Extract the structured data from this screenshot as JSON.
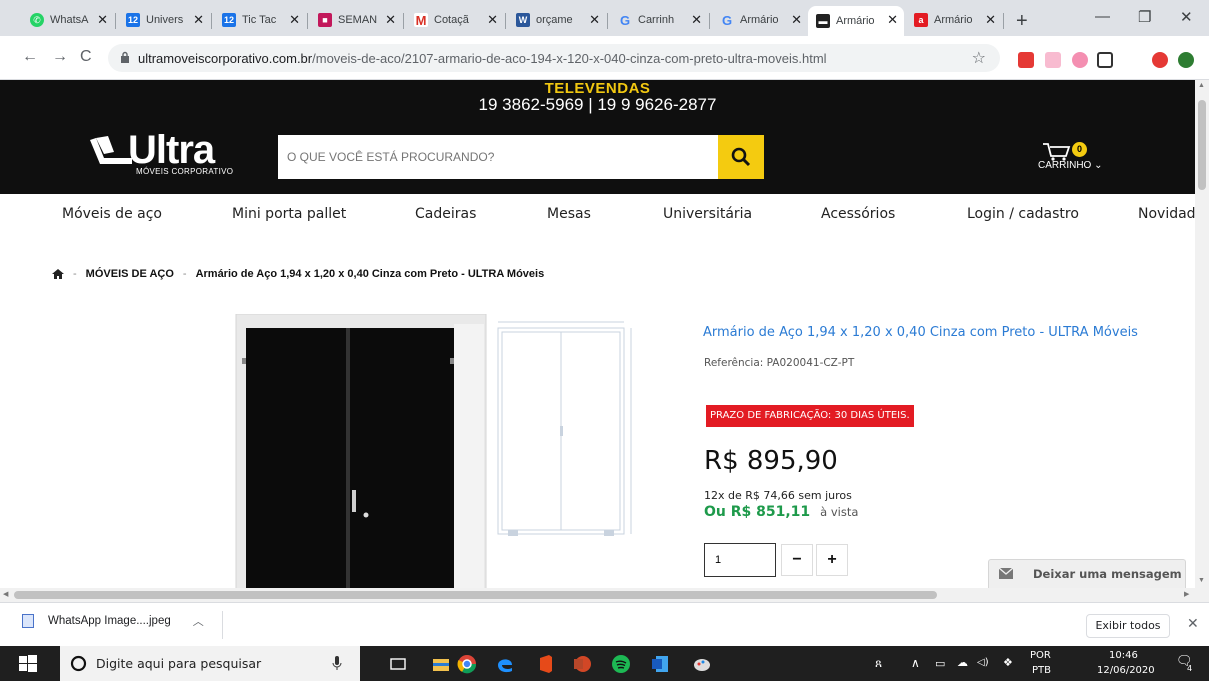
{
  "browser": {
    "tabs": [
      {
        "label": "WhatsA",
        "icon": "whatsapp-icon",
        "color": "#25d366"
      },
      {
        "label": "Univers",
        "icon": "calendar-icon",
        "color": "#1a73e8"
      },
      {
        "label": "Tic Tac",
        "icon": "calendar-icon",
        "color": "#1a73e8"
      },
      {
        "label": "SEMAN",
        "icon": "classroom-icon",
        "color": "#c2185b"
      },
      {
        "label": "Cotaçã",
        "icon": "gmail-icon",
        "color": "#d93025"
      },
      {
        "label": "orçame",
        "icon": "word-icon",
        "color": "#2b579a"
      },
      {
        "label": "Carrinh",
        "icon": "google-icon",
        "color": "#4285f4"
      },
      {
        "label": "Armário",
        "icon": "google-icon",
        "color": "#4285f4"
      },
      {
        "label": "Armário",
        "icon": "ultra-icon",
        "color": "#222222"
      },
      {
        "label": "Armário",
        "icon": "a-icon",
        "color": "#e31b23"
      }
    ],
    "url_host": "ultramoveiscorporativo.com.br",
    "url_path": "/moveis-de-aco/2107-armario-de-aco-194-x-120-x-040-cinza-com-preto-ultra-moveis.html"
  },
  "site": {
    "televendas_title": "TELEVENDAS",
    "televendas_phones": "19 3862-5969  |  19 9 9626-2877",
    "logo_text": "Ultra",
    "logo_sub": "MÓVEIS CORPORATIVO",
    "search_placeholder": "O QUE VOCÊ ESTÁ PROCURANDO?",
    "cart_count": "0",
    "cart_label": "CARRINHO ⌄",
    "menu": [
      "Móveis de aço",
      "Mini porta pallet",
      "Cadeiras",
      "Mesas",
      "Universitária",
      "Acessórios",
      "Login / cadastro",
      "Novidad"
    ]
  },
  "breadcrumb": {
    "sep": "-",
    "category": "MÓVEIS DE AÇO",
    "current": "Armário de Aço 1,94 x 1,20 x 0,40 Cinza com Preto - ULTRA Móveis"
  },
  "product": {
    "title": "Armário de Aço 1,94 x 1,20 x 0,40 Cinza com Preto - ULTRA Móveis",
    "reference": "Referência: PA020041-CZ-PT",
    "prazo": "PRAZO DE FABRICAÇÃO: 30 DIAS ÚTEIS.",
    "price": "R$ 895,90",
    "installments": "12x de R$ 74,66 sem juros",
    "cash_price": "Ou R$ 851,11",
    "cash_label": "à vista",
    "quantity": "1",
    "minus": "−",
    "plus": "+"
  },
  "chat": {
    "label": "Deixar uma mensagem"
  },
  "downloads": {
    "file": "WhatsApp Image....jpeg",
    "show_all": "Exibir todos"
  },
  "taskbar": {
    "search_placeholder": "Digite aqui para pesquisar",
    "lang_1": "POR",
    "lang_2": "PTB",
    "time": "10:46",
    "date": "12/06/2020",
    "notifications": "4"
  }
}
